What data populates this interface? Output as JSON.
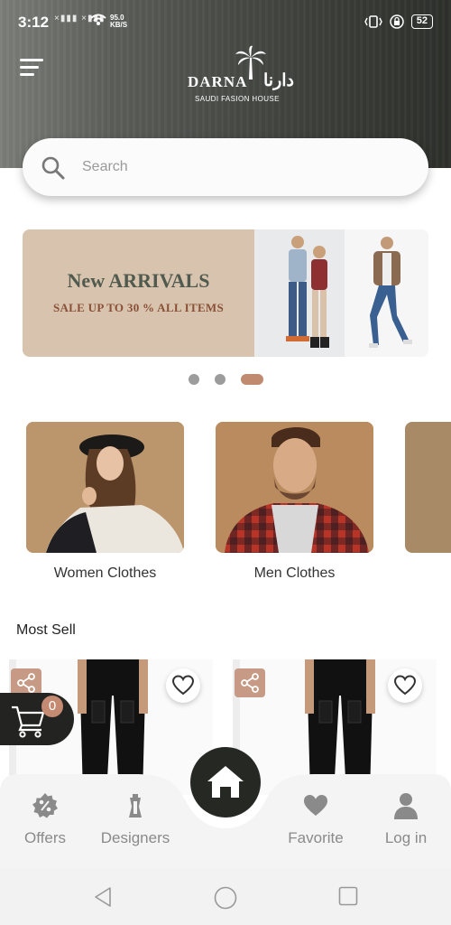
{
  "status_bar": {
    "time": "3:12",
    "network_speed_value": "95.0",
    "network_speed_unit": "KB/S",
    "battery": "52"
  },
  "header": {
    "brand_name": "DARNA",
    "brand_arabic": "دارنا",
    "brand_tagline": "SAUDI FASION HOUSE"
  },
  "search": {
    "placeholder": "Search"
  },
  "banner": {
    "title": "New ARRIVALS",
    "subtitle": "SALE UP TO 30 % ALL ITEMS",
    "slide_count": 3,
    "active_slide": 3
  },
  "categories": [
    {
      "label": "Women Clothes"
    },
    {
      "label": "Men Clothes"
    },
    {
      "label": ""
    }
  ],
  "most_sell": {
    "title": "Most Sell"
  },
  "cart": {
    "count": "0"
  },
  "bottom_nav": {
    "items": [
      {
        "label": "Offers",
        "icon": "percent-badge-icon"
      },
      {
        "label": "Designers",
        "icon": "designer-icon"
      },
      {
        "label": "Favorite",
        "icon": "heart-icon"
      },
      {
        "label": "Log in",
        "icon": "user-icon"
      }
    ],
    "home_icon": "home-icon"
  },
  "colors": {
    "accent": "#c08a70",
    "dark": "#262824",
    "nav_gray": "#8a8a8a"
  }
}
